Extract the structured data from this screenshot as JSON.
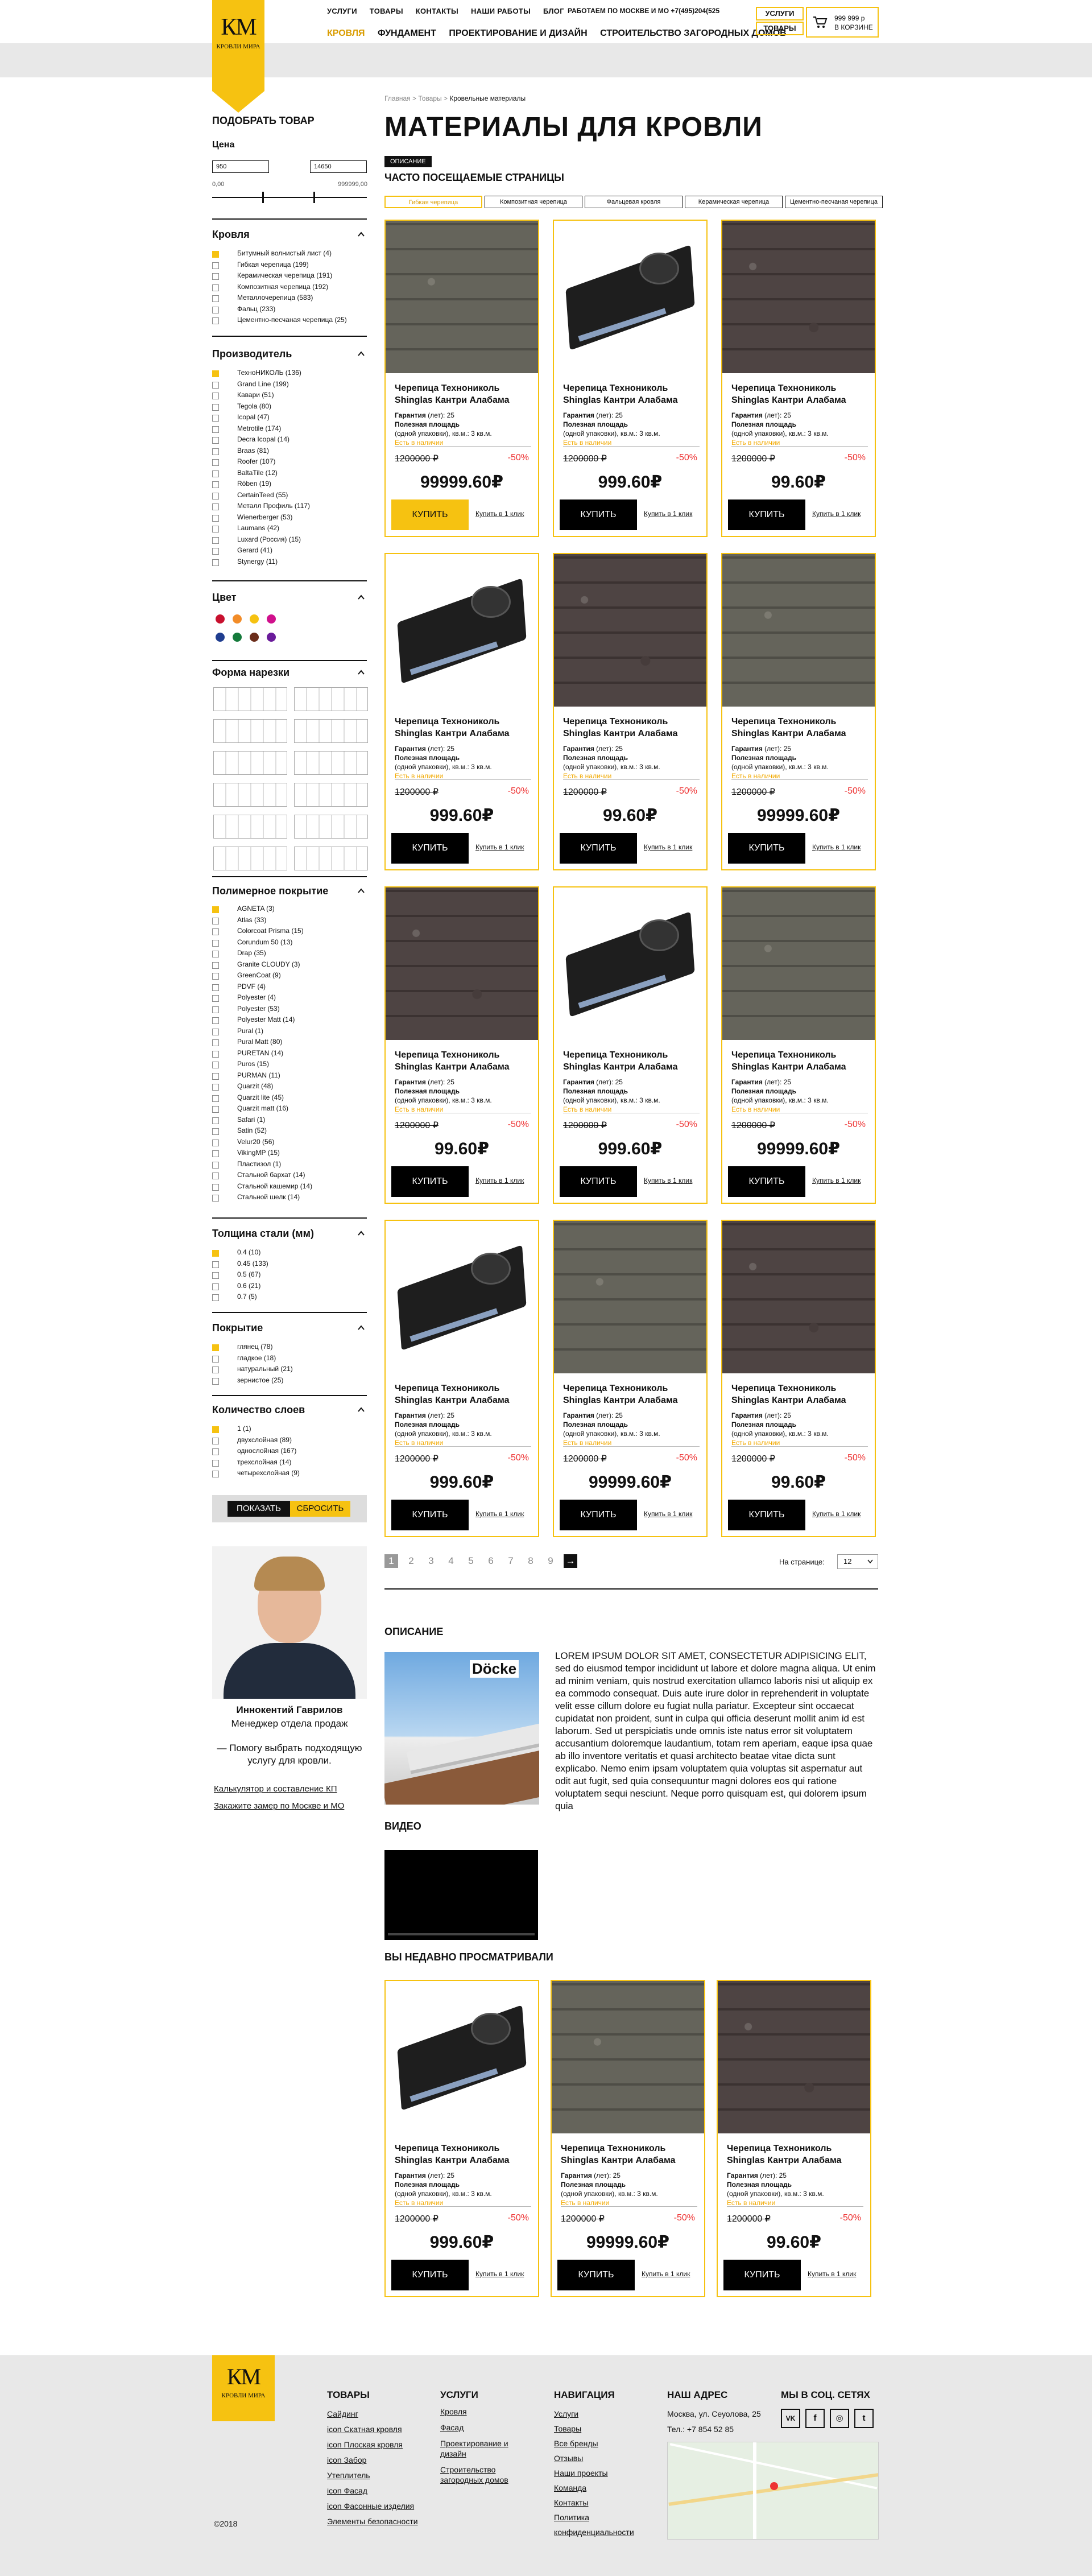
{
  "header": {
    "logo_text": "КМ",
    "logo_sub": "КРОВЛИ МИРА",
    "top_nav": [
      "УСЛУГИ",
      "ТОВАРЫ",
      "КОНТАКТЫ",
      "НАШИ РАБОТЫ",
      "БЛОГ"
    ],
    "work_info": "РАБОТАЕМ ПО МОСКВЕ И МО +7(495)204(525",
    "cat_nav": [
      "КРОВЛЯ",
      "ФУНДАМЕНТ",
      "ПРОЕКТИРОВАНИЕ И ДИЗАЙН",
      "СТРОИТЕЛЬСТВО ЗАГОРОДНЫХ ДОМОВ"
    ],
    "btn_services": "УСЛУГИ",
    "btn_goods": "ТОВАРЫ",
    "cart_sum": "999 999 р",
    "cart_count": "В КОРЗИНЕ",
    "accent": "#f6c211"
  },
  "breadcrumb": {
    "home": "Главная",
    "goods": "Товары",
    "current": "Кровельные материалы"
  },
  "page_title": "МАТЕРИАЛЫ ДЛЯ КРОВЛИ",
  "desc_tab": "ОПИСАНИЕ",
  "freq_title": "ЧАСТО ПОСЕЩАЕМЫЕ СТРАНИЦЫ",
  "freq_chips": [
    "Гибкая черепица",
    "Композитная черепица",
    "Фальцевая кровля",
    "Керамическая черепица",
    "Цементно-песчаная черепица"
  ],
  "sidebar": {
    "title": "ПОДОБРАТЬ ТОВАР",
    "price_h": "Цена",
    "price_from": "950",
    "price_to": "14650",
    "price_min": "0,00",
    "price_max": "999999,00",
    "roof_h": "Кровля",
    "roof_items": [
      "Битумный волнистый лист (4)",
      "Гибкая черепица (199)",
      "Керамическая черепица (191)",
      "Композитная черепица (192)",
      "Металлочерепица (583)",
      "Фальц (233)",
      "Цементно-песчаная черепица (25)"
    ],
    "maker_h": "Производитель",
    "maker_items": [
      "ТехноНИКОЛЬ (136)",
      "Grand Line (199)",
      "Кавари (51)",
      "Tegola (80)",
      "Icopal (47)",
      "Metrotile (174)",
      "Decra Icopal (14)",
      "Braas (81)",
      "Roofer (107)",
      "BaltaTile (12)",
      "Röben (19)",
      "CertainTeed (55)",
      "Металл Профиль (117)",
      "Wienerberger (53)",
      "Laumans (42)",
      "Luxard (Россия) (15)",
      "Gerard (41)",
      "Stynergy (11)"
    ],
    "color_h": "Цвет",
    "colors": [
      "#c8102e",
      "#f28c28",
      "#f6c211",
      "#d0108c",
      "#1f3d8f",
      "#157a3b",
      "#6b2d1a",
      "#6a1b9a"
    ],
    "cut_h": "Форма нарезки",
    "poly_h": "Полимерное покрытие",
    "poly_items": [
      "AGNETA (3)",
      "Atlas (33)",
      "Colorcoat Prisma (15)",
      "Corundum 50 (13)",
      "Drap (35)",
      "Granite CLOUDY (3)",
      "GreenCoat (9)",
      "PDVF (4)",
      "Polyester (4)",
      "Polyester (53)",
      "Polyester Matt (14)",
      "Pural (1)",
      "Pural Matt (80)",
      "PURETAN (14)",
      "Puros (15)",
      "PURMAN (11)",
      "Quarzit (48)",
      "Quarzit lite (45)",
      "Quarzit matt (16)",
      "Safari (1)",
      "Satin (52)",
      "Velur20 (56)",
      "VikingMP (15)",
      "Пластизол (1)",
      "Стальной бархат (14)",
      "Стальной кашемир (14)",
      "Стальной шелк (14)"
    ],
    "thick_h": "Толщина стали (мм)",
    "thick_items": [
      "0.4 (10)",
      "0.45 (133)",
      "0.5 (67)",
      "0.6 (21)",
      "0.7 (5)"
    ],
    "cover_h": "Покрытие",
    "cover_items": [
      "глянец (78)",
      "гладкое (18)",
      "натуральный (21)",
      "зернистое (25)"
    ],
    "layers_h": "Количество слоев",
    "layers_items": [
      "1 (1)",
      "двухслойная (89)",
      "однослойная (167)",
      "трехслойная (14)",
      "четырехслойная (9)"
    ],
    "btn_show": "ПОКАЗАТЬ",
    "btn_reset": "СБРОСИТЬ"
  },
  "product_common": {
    "title": "Черепица Технониколь Shinglas Кантри Алабама",
    "warranty": "(лет): 25",
    "warranty_label": "Гарантия",
    "area_label": "Полезная площадь",
    "area_value": "(одной упаковки), кв.м.: 3 кв.м.",
    "stock": "Есть в наличии",
    "old_price": "1200000 ₽",
    "discount": "-50%",
    "buy": "КУПИТЬ",
    "one_click": "Купить в 1 клик"
  },
  "products": [
    {
      "price": "99999.60₽",
      "img": "shingle green"
    },
    {
      "price": "999.60₽",
      "img": "roll"
    },
    {
      "price": "99.60₽",
      "img": "shingle"
    },
    {
      "price": "999.60₽",
      "img": "roll"
    },
    {
      "price": "99.60₽",
      "img": "shingle"
    },
    {
      "price": "99999.60₽",
      "img": "shingle green"
    },
    {
      "price": "99.60₽",
      "img": "shingle"
    },
    {
      "price": "999.60₽",
      "img": "roll"
    },
    {
      "price": "99999.60₽",
      "img": "shingle green"
    },
    {
      "price": "999.60₽",
      "img": "roll"
    },
    {
      "price": "99999.60₽",
      "img": "shingle green"
    },
    {
      "price": "99.60₽",
      "img": "shingle"
    }
  ],
  "pagination": {
    "pages": [
      "1",
      "2",
      "3",
      "4",
      "5",
      "6",
      "7",
      "8",
      "9",
      "→"
    ],
    "per_page_label": "На странице:",
    "per_page": "12"
  },
  "manager": {
    "name": "Иннокентий Гаврилов",
    "role": "Менеджер отдела продаж",
    "text": "— Помогу выбрать подходящую услугу для кровли.",
    "link1": "Калькулятор и составление КП",
    "link2": "Закажите замер по Москве и МО"
  },
  "description": {
    "title": "ОПИСАНИЕ",
    "img_brand": "Döcke",
    "lead": "Lorem ipsum dolor sit amet, consectetur adipisicing elit,",
    "text": "sed do eiusmod tempor incididunt ut labore et dolore magna aliqua. Ut enim ad minim veniam, quis nostrud exercitation ullamco laboris nisi ut aliquip ex ea commodo consequat. Duis aute irure dolor in reprehenderit in voluptate velit esse cillum dolore eu fugiat nulla pariatur. Excepteur sint occaecat cupidatat non proident, sunt in culpa qui officia deserunt mollit anim id est laborum. Sed ut perspiciatis unde omnis iste natus error sit voluptatem accusantium doloremque laudantium, totam rem aperiam, eaque ipsa quae ab illo inventore veritatis et quasi architecto beatae vitae dicta sunt explicabo. Nemo enim ipsam voluptatem quia voluptas sit aspernatur aut odit aut fugit, sed quia consequuntur magni dolores eos qui ratione voluptatem sequi nesciunt. Neque porro quisquam est, qui dolorem ipsum quia",
    "video_title": "ВИДЕО"
  },
  "recent": {
    "title": "ВЫ НЕДАВНО ПРОСМАТРИВАЛИ",
    "items": [
      {
        "price": "999.60₽",
        "img": "roll"
      },
      {
        "price": "99999.60₽",
        "img": "shingle green"
      },
      {
        "price": "99.60₽",
        "img": "shingle"
      }
    ]
  },
  "footer": {
    "logo_text": "КМ",
    "logo_sub": "КРОВЛИ МИРА",
    "goods_h": "ТОВАРЫ",
    "goods": [
      "Сайдинг",
      "icon Скатная кровля",
      "icon Плоская кровля",
      "icon Забор",
      "Утеплитель",
      "icon Фасад",
      "icon Фасонные изделия",
      "Элементы безопасности"
    ],
    "services_h": "УСЛУГИ",
    "services": [
      "Кровля",
      "Фасад",
      "Проектирование и дизайн",
      "Строительство загородных домов"
    ],
    "nav_h": "НАВИГАЦИЯ",
    "nav": [
      "Услуги",
      "Товары",
      "Все бренды",
      "Отзывы",
      "Наши проекты",
      "Команда",
      "Контакты",
      "Политика конфиденциальности"
    ],
    "addr_h": "НАШ АДРЕС",
    "addr": "Москва, ул. Сеуолова, 25",
    "phone": "Тел.: +7 854 52 85",
    "social_h": "МЫ В СОЦ. СЕТЯХ",
    "social": [
      "VK",
      "f",
      "◎",
      "t"
    ],
    "copyright": "©2018"
  }
}
